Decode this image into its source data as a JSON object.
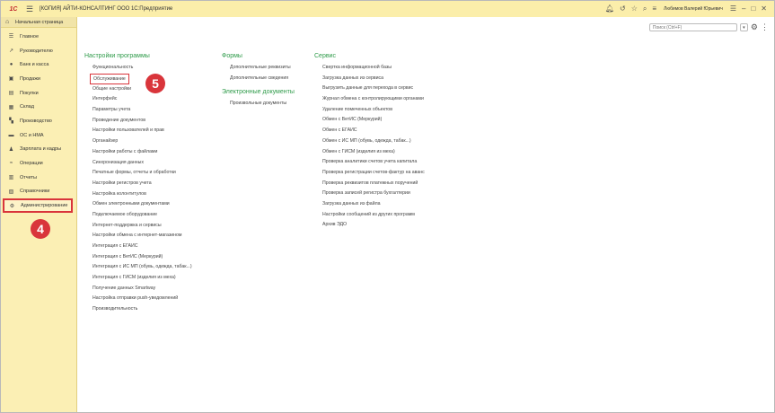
{
  "titlebar": {
    "logo": "1С",
    "title": "[КОПИЯ] АЙТИ-КОНСАЛТИНГ ООО 1С:Предприятие",
    "user": "Любимов Валерий Юрьевич"
  },
  "sidebar": {
    "home": "Начальная страница",
    "items": [
      {
        "label": "Главное",
        "icon": "☰"
      },
      {
        "label": "Руководителю",
        "icon": "↗"
      },
      {
        "label": "Банк и касса",
        "icon": "●"
      },
      {
        "label": "Продажи",
        "icon": "▣"
      },
      {
        "label": "Покупки",
        "icon": "▤"
      },
      {
        "label": "Склад",
        "icon": "▦"
      },
      {
        "label": "Производство",
        "icon": "▚"
      },
      {
        "label": "ОС и НМА",
        "icon": "▬"
      },
      {
        "label": "Зарплата и кадры",
        "icon": "♟"
      },
      {
        "label": "Операции",
        "icon": "≈"
      },
      {
        "label": "Отчеты",
        "icon": "▥"
      },
      {
        "label": "Справочники",
        "icon": "▧"
      },
      {
        "label": "Администрирование",
        "icon": "⚙"
      }
    ]
  },
  "badges": {
    "step4": "4",
    "step5": "5"
  },
  "search": {
    "placeholder": "Поиск (Ctrl+F)",
    "dropdown": "▾",
    "more": "⋮"
  },
  "sections": {
    "settings": {
      "title": "Настройки программы",
      "items": [
        "Функциональность",
        "Обслуживание",
        "Общие настройки",
        "Интерфейс",
        "Параметры учета",
        "Проведение документов",
        "Настройки пользователей и прав",
        "Органайзер",
        "Настройки работы с файлами",
        "Синхронизация данных",
        "Печатные формы, отчеты и обработки",
        "Настройки регистров учета",
        "Настройка колонтитулов",
        "Обмен электронными документами",
        "Подключаемое оборудование",
        "Интернет-поддержка и сервисы",
        "Настройки обмена с интернет-магазином",
        "Интеграция с ЕГАИС",
        "Интеграция с ВетИС (Меркурий)",
        "Интеграция с ИС МП (обувь, одежда, табак...)",
        "Интеграция с ГИСМ (изделия из меха)",
        "Получение данных Smartway",
        "Настройка отправки push-уведомлений",
        "Производительность"
      ]
    },
    "forms": {
      "title": "Формы",
      "items": [
        "Дополнительные реквизиты",
        "Дополнительные сведения"
      ]
    },
    "edocs": {
      "title": "Электронные документы",
      "items": [
        "Произвольные документы"
      ]
    },
    "service": {
      "title": "Сервис",
      "items": [
        "Свертка информационной базы",
        "Загрузка данных из сервиса",
        "Выгрузить данные для перехода в сервис",
        "Журнал обмена с контролирующими органами",
        "Удаление помеченных объектов",
        "Обмен с ВетИС (Меркурий)",
        "Обмен с ЕГАИС",
        "Обмен с ИС МП (обувь, одежда, табак...)",
        "Обмен с ГИСМ (изделия из меха)",
        "Проверка аналитики счетов учета капитала",
        "Проверка регистрации счетов-фактур на аванс",
        "Проверка реквизитов платежных поручений",
        "Проверка записей регистра бухгалтерии",
        "Загрузка данных из файла",
        "Настройки сообщений из других программ",
        "Архив ЭДО"
      ]
    }
  }
}
